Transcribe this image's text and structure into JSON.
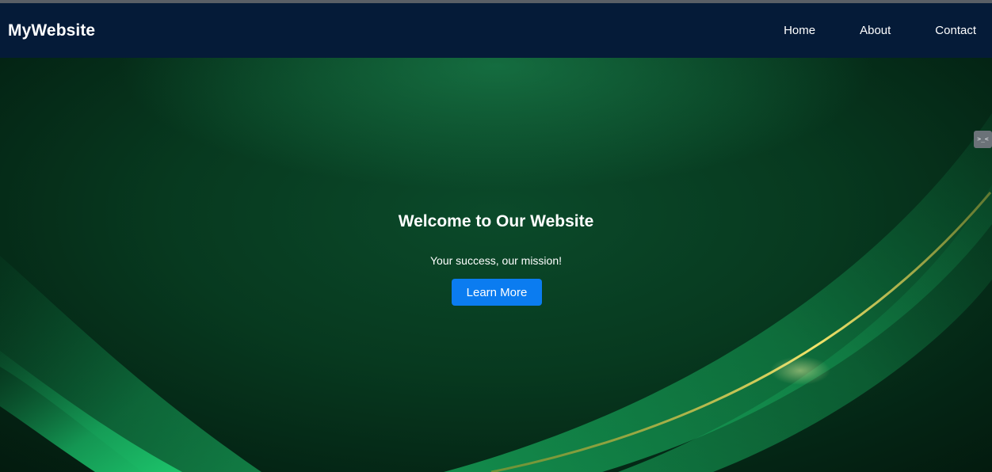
{
  "navbar": {
    "brand": "MyWebsite",
    "links": [
      {
        "label": "Home"
      },
      {
        "label": "About"
      },
      {
        "label": "Contact"
      }
    ]
  },
  "hero": {
    "title": "Welcome to Our Website",
    "subtitle": "Your success, our mission!",
    "cta_label": "Learn More"
  },
  "corner_widget": {
    "glyph": ">_<",
    "icon": "extension-icon"
  },
  "colors": {
    "navbar_bg": "#051b38",
    "hero_green": "#0b4a2a",
    "cta_blue": "#0b7cf0",
    "accent_gold": "#d8c24a"
  }
}
